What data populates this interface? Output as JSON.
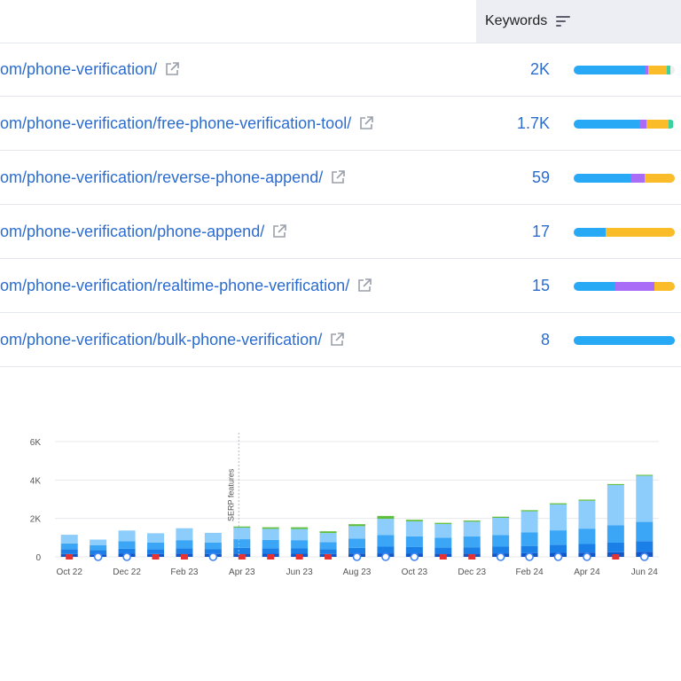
{
  "header": {
    "keywords_label": "Keywords"
  },
  "rows": [
    {
      "url": "om/phone-verification/",
      "value": "2K",
      "segments": [
        0.7,
        0.04,
        0.18,
        0.04
      ]
    },
    {
      "url": "om/phone-verification/free-phone-verification-tool/",
      "value": "1.7K",
      "segments": [
        0.65,
        0.07,
        0.22,
        0.04
      ]
    },
    {
      "url": "om/phone-verification/reverse-phone-append/",
      "value": "59",
      "segments": [
        0.56,
        0.14,
        0.3,
        0
      ]
    },
    {
      "url": "om/phone-verification/phone-append/",
      "value": "17",
      "segments": [
        0.32,
        0,
        0.68,
        0
      ]
    },
    {
      "url": "om/phone-verification/realtime-phone-verification/",
      "value": "15",
      "segments": [
        0.4,
        0.4,
        0.2,
        0
      ]
    },
    {
      "url": "om/phone-verification/bulk-phone-verification/",
      "value": "8",
      "segments": [
        1.0,
        0,
        0,
        0
      ]
    }
  ],
  "colors": {
    "seg": [
      "#28a9f5",
      "#a86cf7",
      "#fbbc2a",
      "#3ed1a0"
    ],
    "link": "#2b6cd1"
  },
  "chart_data": {
    "type": "bar",
    "y_ticks": [
      "0",
      "2K",
      "4K",
      "6K"
    ],
    "ylim": [
      0,
      6000
    ],
    "x_labels": [
      "Oct 22",
      "Dec 22",
      "Feb 23",
      "Apr 23",
      "Jun 23",
      "Aug 23",
      "Oct 23",
      "Dec 23",
      "Feb 24",
      "Apr 24",
      "Jun 24"
    ],
    "annotation": "SERP features",
    "annotation_bar_index": 6,
    "series_colors": [
      "#1257c7",
      "#1a7fe6",
      "#3ba6f5",
      "#8dcdfb",
      "#5fbf3d"
    ],
    "bars": [
      [
        150,
        250,
        300,
        450,
        0
      ],
      [
        130,
        220,
        250,
        300,
        0
      ],
      [
        160,
        260,
        400,
        550,
        0
      ],
      [
        150,
        250,
        350,
        480,
        0
      ],
      [
        170,
        280,
        420,
        620,
        0
      ],
      [
        150,
        260,
        340,
        500,
        0
      ],
      [
        170,
        300,
        450,
        600,
        60
      ],
      [
        160,
        290,
        430,
        580,
        80
      ],
      [
        160,
        280,
        430,
        580,
        90
      ],
      [
        150,
        240,
        370,
        480,
        90
      ],
      [
        170,
        300,
        480,
        650,
        100
      ],
      [
        180,
        350,
        600,
        850,
        150
      ],
      [
        180,
        330,
        560,
        780,
        80
      ],
      [
        170,
        310,
        520,
        710,
        60
      ],
      [
        170,
        330,
        560,
        770,
        60
      ],
      [
        180,
        350,
        600,
        900,
        60
      ],
      [
        190,
        380,
        700,
        1100,
        60
      ],
      [
        210,
        420,
        750,
        1350,
        60
      ],
      [
        220,
        450,
        800,
        1450,
        60
      ],
      [
        240,
        500,
        900,
        2100,
        50
      ],
      [
        260,
        560,
        1000,
        2400,
        50
      ]
    ],
    "markers": [
      "flag",
      "google",
      "google",
      "flag",
      "flag",
      "google",
      "flag",
      "flag",
      "flag",
      "flag",
      "google",
      "google",
      "google",
      "flag",
      "flag",
      "google",
      "google",
      "google",
      "google",
      "flag",
      "google"
    ]
  }
}
